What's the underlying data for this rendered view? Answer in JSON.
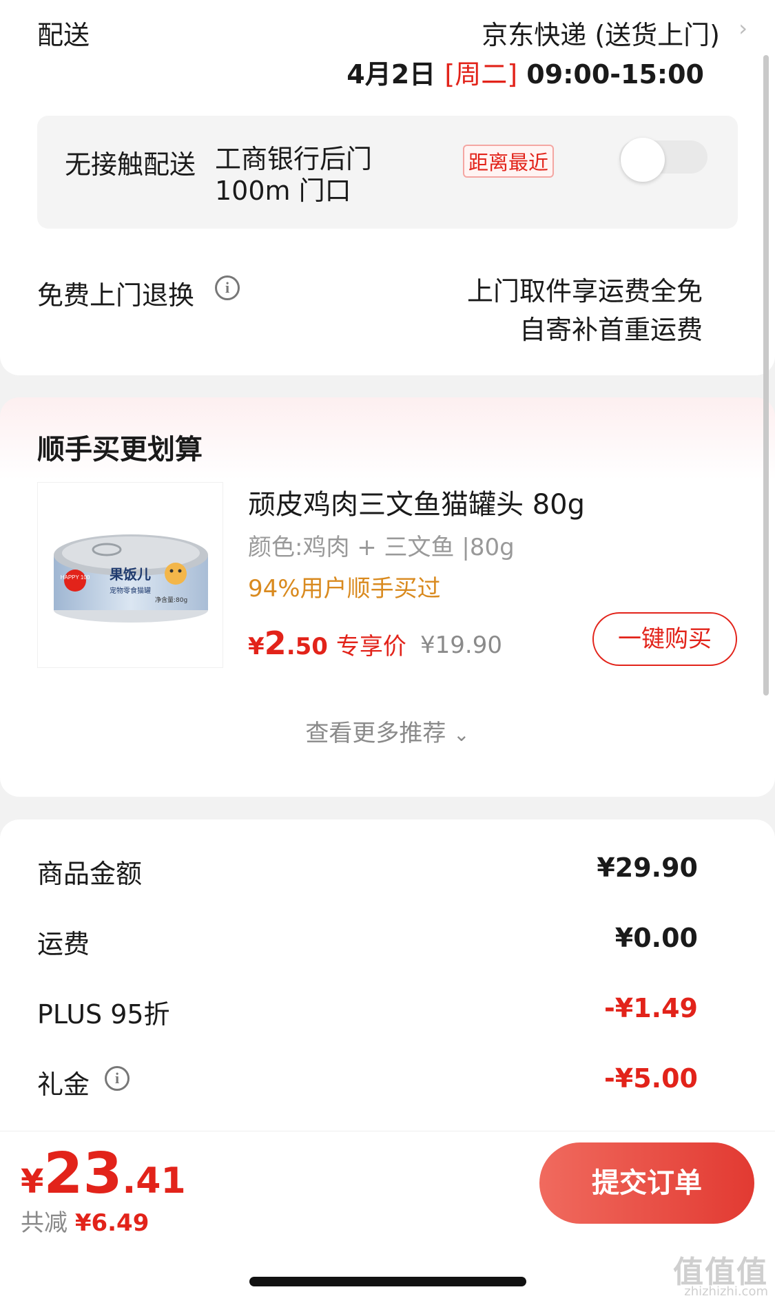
{
  "delivery": {
    "label": "配送",
    "carrier": "京东快递 (送货上门)",
    "date_prefix": "4月2日 ",
    "weekday": "[周二]",
    "time": " 09:00-15:00",
    "contactless": {
      "title": "无接触配送",
      "location": "工商银行后门 100m 门口",
      "badge": "距离最近",
      "toggle_on": false
    },
    "free_return": {
      "label": "免费上门退换",
      "line1": "上门取件享运费全免",
      "line2": "自寄补首重运费"
    }
  },
  "recommendation": {
    "title": "顺手买更划算",
    "product": {
      "name": "顽皮鸡肉三文鱼猫罐头 80g",
      "spec": "颜色:鸡肉 + 三文鱼 |80g",
      "bought": "94%用户顺手买过",
      "price_currency": "¥",
      "price_int": "2",
      "price_dec": ".50",
      "price_tag": "专享价",
      "price_orig": "¥19.90",
      "buy_label": "一键购买",
      "can_brand": "HAPPY 100",
      "can_title": "果饭儿",
      "can_sub": "宠物零食猫罐",
      "can_weight": "净含量:80g"
    },
    "more_label": "查看更多推荐"
  },
  "amounts": [
    {
      "label": "商品金额",
      "value": "¥29.90",
      "red": false
    },
    {
      "label": "运费",
      "value": "¥0.00",
      "red": false
    },
    {
      "label": "PLUS 95折",
      "value": "-¥1.49",
      "red": true
    },
    {
      "label": "礼金",
      "value": "-¥5.00",
      "red": true
    }
  ],
  "bottom": {
    "total_currency": "¥",
    "total_int": "23",
    "total_dec": ".41",
    "saved_prefix": "共减 ",
    "saved_value": "¥6.49",
    "submit_label": "提交订单"
  },
  "watermark": {
    "logo": "值值值",
    "url": "zhizhizhi.com"
  },
  "colors": {
    "accent": "#e2231a",
    "orange": "#d98a1f"
  }
}
